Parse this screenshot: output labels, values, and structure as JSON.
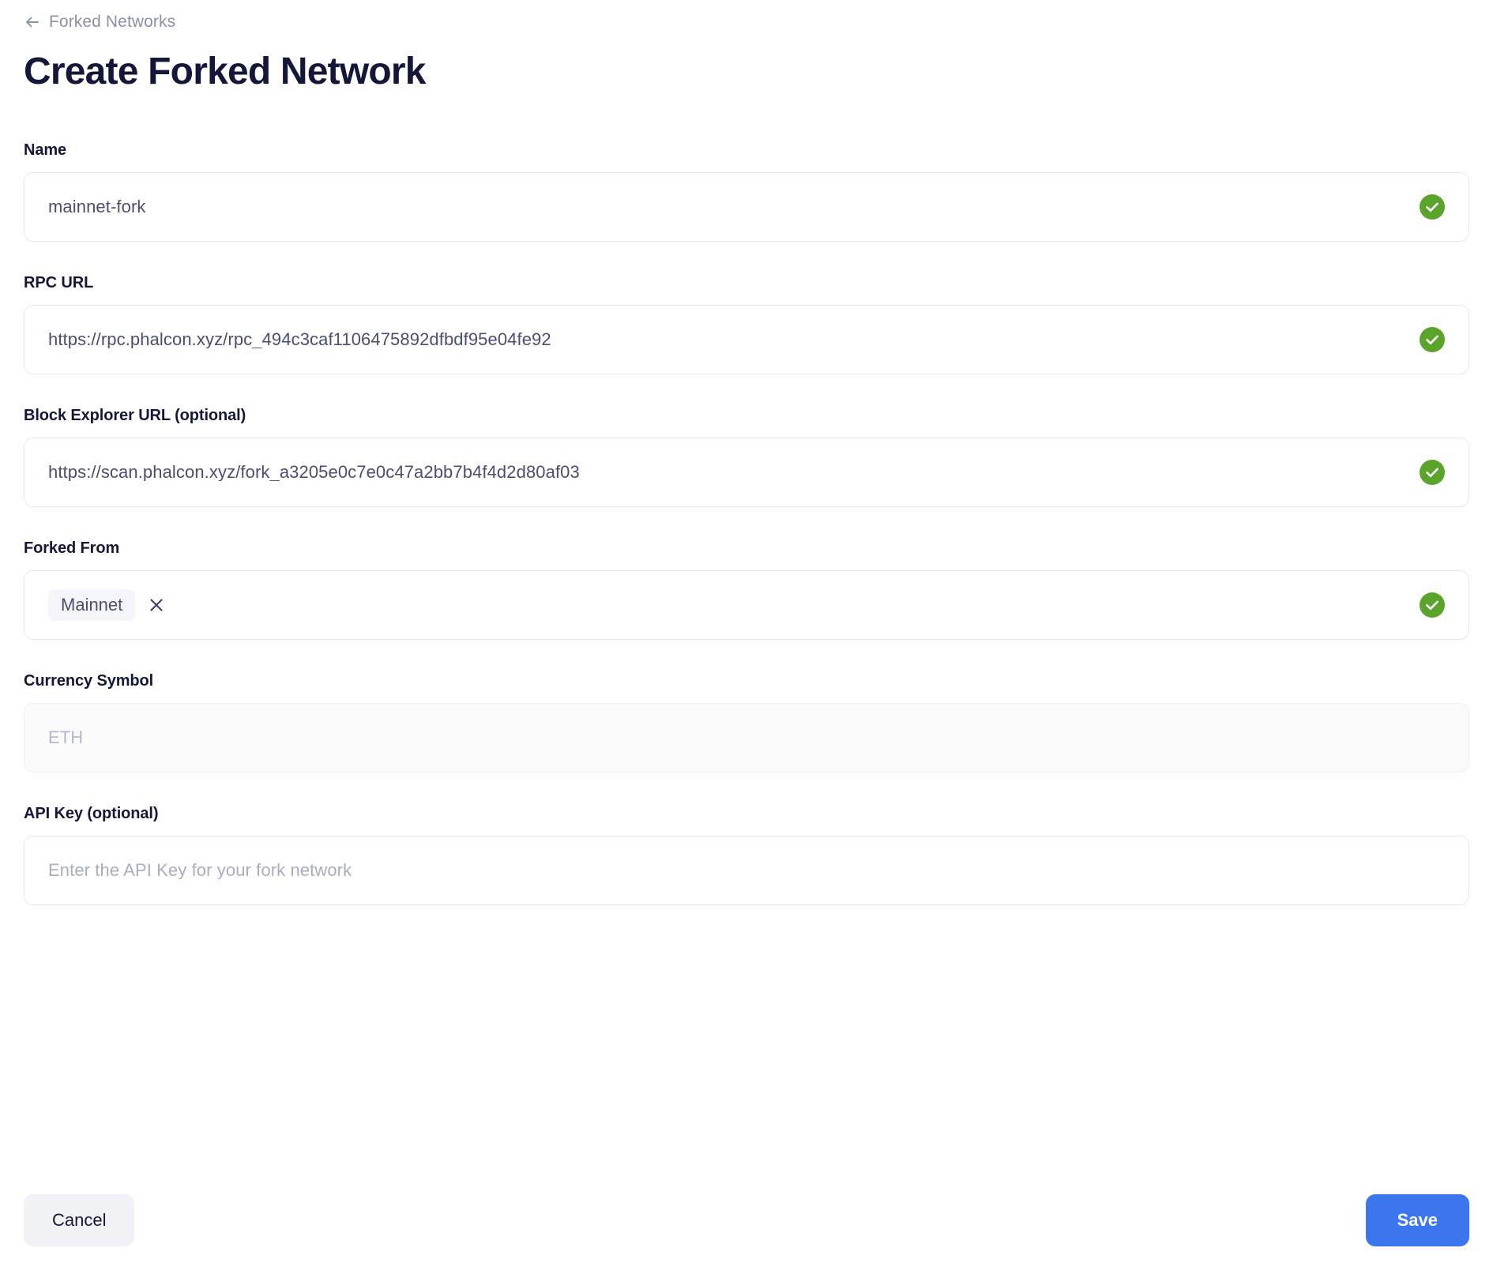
{
  "breadcrumb": {
    "icon": "arrow-left-icon",
    "label": "Forked Networks"
  },
  "page_title": "Create Forked Network",
  "colors": {
    "title": "#15173a",
    "muted": "#8b90ad",
    "input_text": "#4a4e73",
    "placeholder": "#a9adc2",
    "border": "#e7e8ef",
    "valid_green": "#5aa42c",
    "primary_blue": "#3b76ef",
    "cancel_bg": "#f1f2f6",
    "chip_bg": "#f4f5f8",
    "disabled_bg": "#fafafb"
  },
  "form": {
    "fields": [
      {
        "id": "name",
        "label": "Name",
        "value": "mainnet-fork",
        "placeholder": "",
        "state": "valid",
        "status_icon": "check-circle-icon",
        "disabled": false
      },
      {
        "id": "rpc_url",
        "label": "RPC URL",
        "value": "https://rpc.phalcon.xyz/rpc_494c3caf1106475892dfbdf95e04fe92",
        "placeholder": "",
        "state": "valid",
        "status_icon": "check-circle-icon",
        "disabled": false
      },
      {
        "id": "block_explorer_url",
        "label": "Block Explorer URL (optional)",
        "value": "https://scan.phalcon.xyz/fork_a3205e0c7e0c47a2bb7b4f4d2d80af03",
        "placeholder": "",
        "state": "valid",
        "status_icon": "check-circle-icon",
        "disabled": false
      },
      {
        "id": "forked_from",
        "label": "Forked From",
        "chip": {
          "label": "Mainnet",
          "remove_icon": "close-icon"
        },
        "state": "valid",
        "status_icon": "check-circle-icon",
        "disabled": false
      },
      {
        "id": "currency_symbol",
        "label": "Currency Symbol",
        "value": "",
        "placeholder": "ETH",
        "state": "none",
        "disabled": true
      },
      {
        "id": "api_key",
        "label": "API Key (optional)",
        "value": "",
        "placeholder": "Enter the API Key for your fork network",
        "state": "none",
        "disabled": false
      }
    ]
  },
  "footer": {
    "cancel_label": "Cancel",
    "save_label": "Save"
  }
}
